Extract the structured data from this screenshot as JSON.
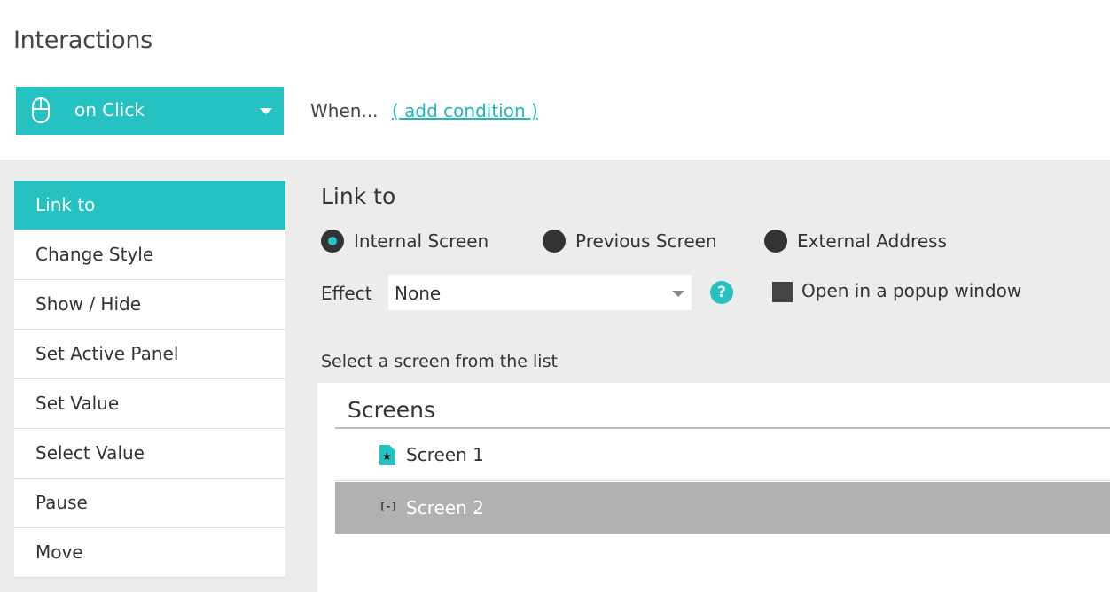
{
  "header": {
    "title": "Interactions"
  },
  "event": {
    "label": "on Click",
    "icon": "mouse-icon"
  },
  "condition": {
    "when_label": "When...",
    "add_link": "( add condition )"
  },
  "actions": [
    {
      "label": "Link to",
      "active": true
    },
    {
      "label": "Change Style"
    },
    {
      "label": "Show / Hide"
    },
    {
      "label": "Set Active Panel"
    },
    {
      "label": "Set Value"
    },
    {
      "label": "Select Value"
    },
    {
      "label": "Pause"
    },
    {
      "label": "Move"
    }
  ],
  "detail": {
    "title": "Link to",
    "targets": [
      {
        "label": "Internal Screen",
        "selected": true
      },
      {
        "label": "Previous Screen",
        "selected": false
      },
      {
        "label": "External Address",
        "selected": false
      }
    ],
    "effect_label": "Effect",
    "effect_value": "None",
    "help_glyph": "?",
    "popup_label": "Open in a popup window",
    "popup_checked": false,
    "select_hint": "Select a screen from the list",
    "screens_header": "Screens",
    "screens": [
      {
        "name": "Screen 1",
        "icon": "home-screen-icon",
        "selected": false
      },
      {
        "name": "Screen 2",
        "icon": "screen-bracket-icon",
        "selected": true
      }
    ]
  },
  "colors": {
    "accent": "#26c1c1",
    "panel_bg": "#ececec",
    "selected_row": "#b1b1b3"
  }
}
